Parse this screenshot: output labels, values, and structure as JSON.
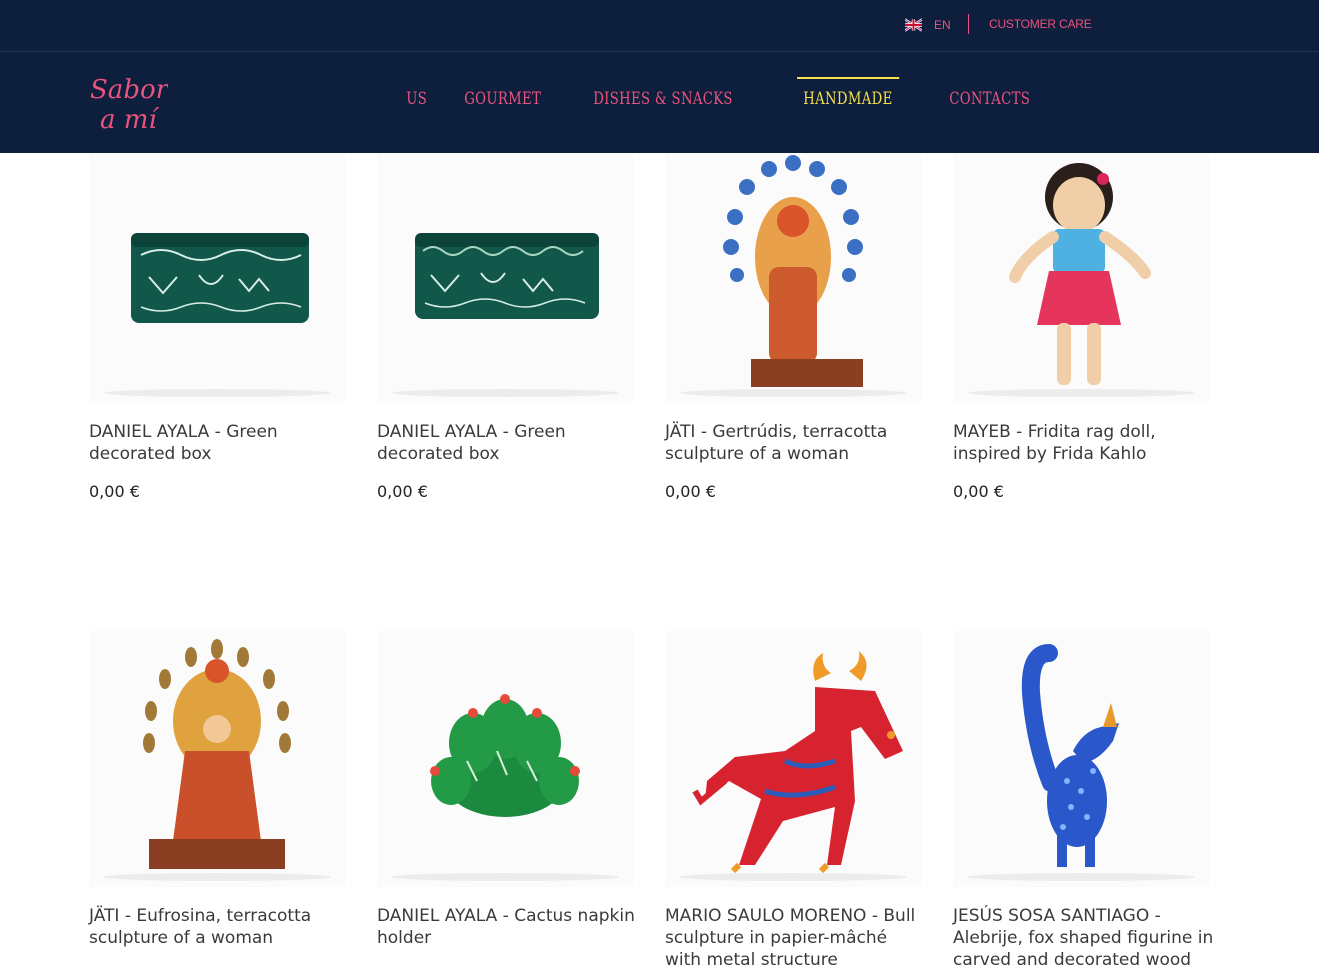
{
  "topbar": {
    "language": "EN",
    "language_flag_icon": "uk-flag-icon",
    "customer_care": "CUSTOMER CARE"
  },
  "brand": {
    "logo_text": "Sabor a mí",
    "logo_color": "#e9537d"
  },
  "nav": {
    "items": [
      "US",
      "GOURMET",
      "DISHES & SNACKS",
      "HANDMADE",
      "CONTACTS"
    ],
    "active": "HANDMADE"
  },
  "colors": {
    "header_bg": "#0e1e3d",
    "accent_pink": "#e9537d",
    "accent_yellow": "#f5df4a"
  },
  "products": [
    {
      "title": "DANIEL AYALA - Green decorated box",
      "price": "0,00 €"
    },
    {
      "title": "DANIEL AYALA - Green decorated box",
      "price": "0,00 €"
    },
    {
      "title": "JÄTI - Gertrúdis, terracotta sculpture of a woman",
      "price": "0,00 €"
    },
    {
      "title": "MAYEB - Fridita rag doll, inspired by Frida Kahlo",
      "price": "0,00 €"
    },
    {
      "title": "JÄTI - Eufrosina, terracotta sculpture of a woman",
      "price": ""
    },
    {
      "title": "DANIEL AYALA - Cactus napkin holder",
      "price": ""
    },
    {
      "title": "MARIO SAULO MORENO - Bull sculpture in papier-mâché with metal structure",
      "price": ""
    },
    {
      "title": "JESÚS SOSA SANTIAGO - Alebrije, fox shaped figurine in carved and decorated wood",
      "price": ""
    }
  ]
}
